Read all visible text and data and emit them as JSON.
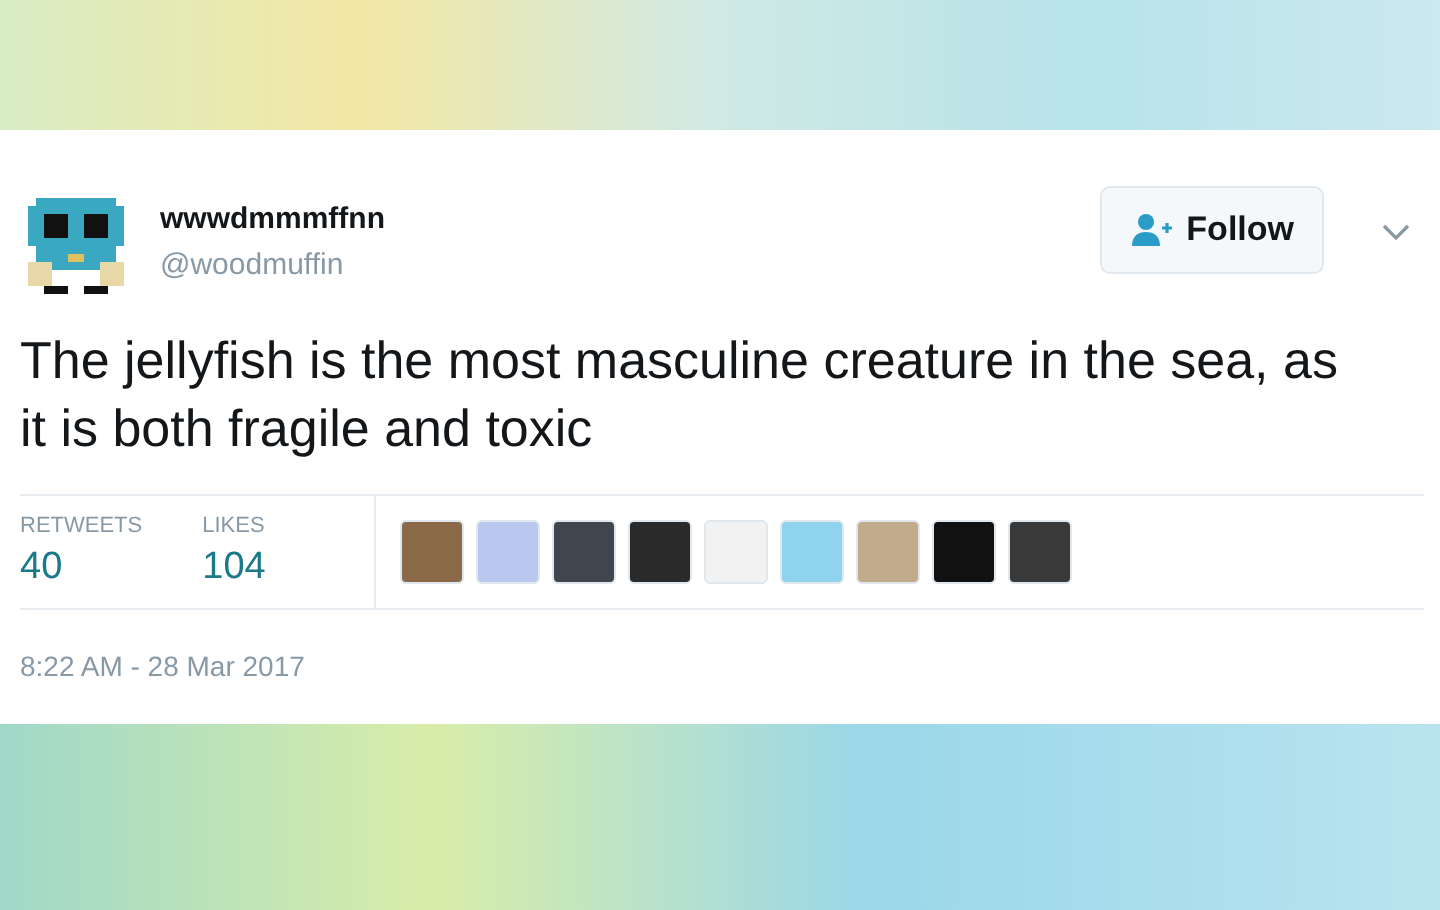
{
  "tweet": {
    "display_name": "wwwdmmmffnn",
    "handle": "@woodmuffin",
    "follow_button": "Follow",
    "text": "The jellyfish is the most masculine creature in the sea, as it is both fragile and toxic",
    "stats": [
      {
        "label": "RETWEETS",
        "value": "40"
      },
      {
        "label": "LIKES",
        "value": "104"
      }
    ],
    "likers": [
      {
        "color": "#8a6a48"
      },
      {
        "color": "#b8c8ee"
      },
      {
        "color": "#404650"
      },
      {
        "color": "#2a2a2a"
      },
      {
        "color": "#f2f2f2"
      },
      {
        "color": "#8fd3ee"
      },
      {
        "color": "#c2ab8a"
      },
      {
        "color": "#111111"
      },
      {
        "color": "#3a3a3a"
      }
    ],
    "timestamp": "8:22 AM - 28 Mar 2017"
  }
}
